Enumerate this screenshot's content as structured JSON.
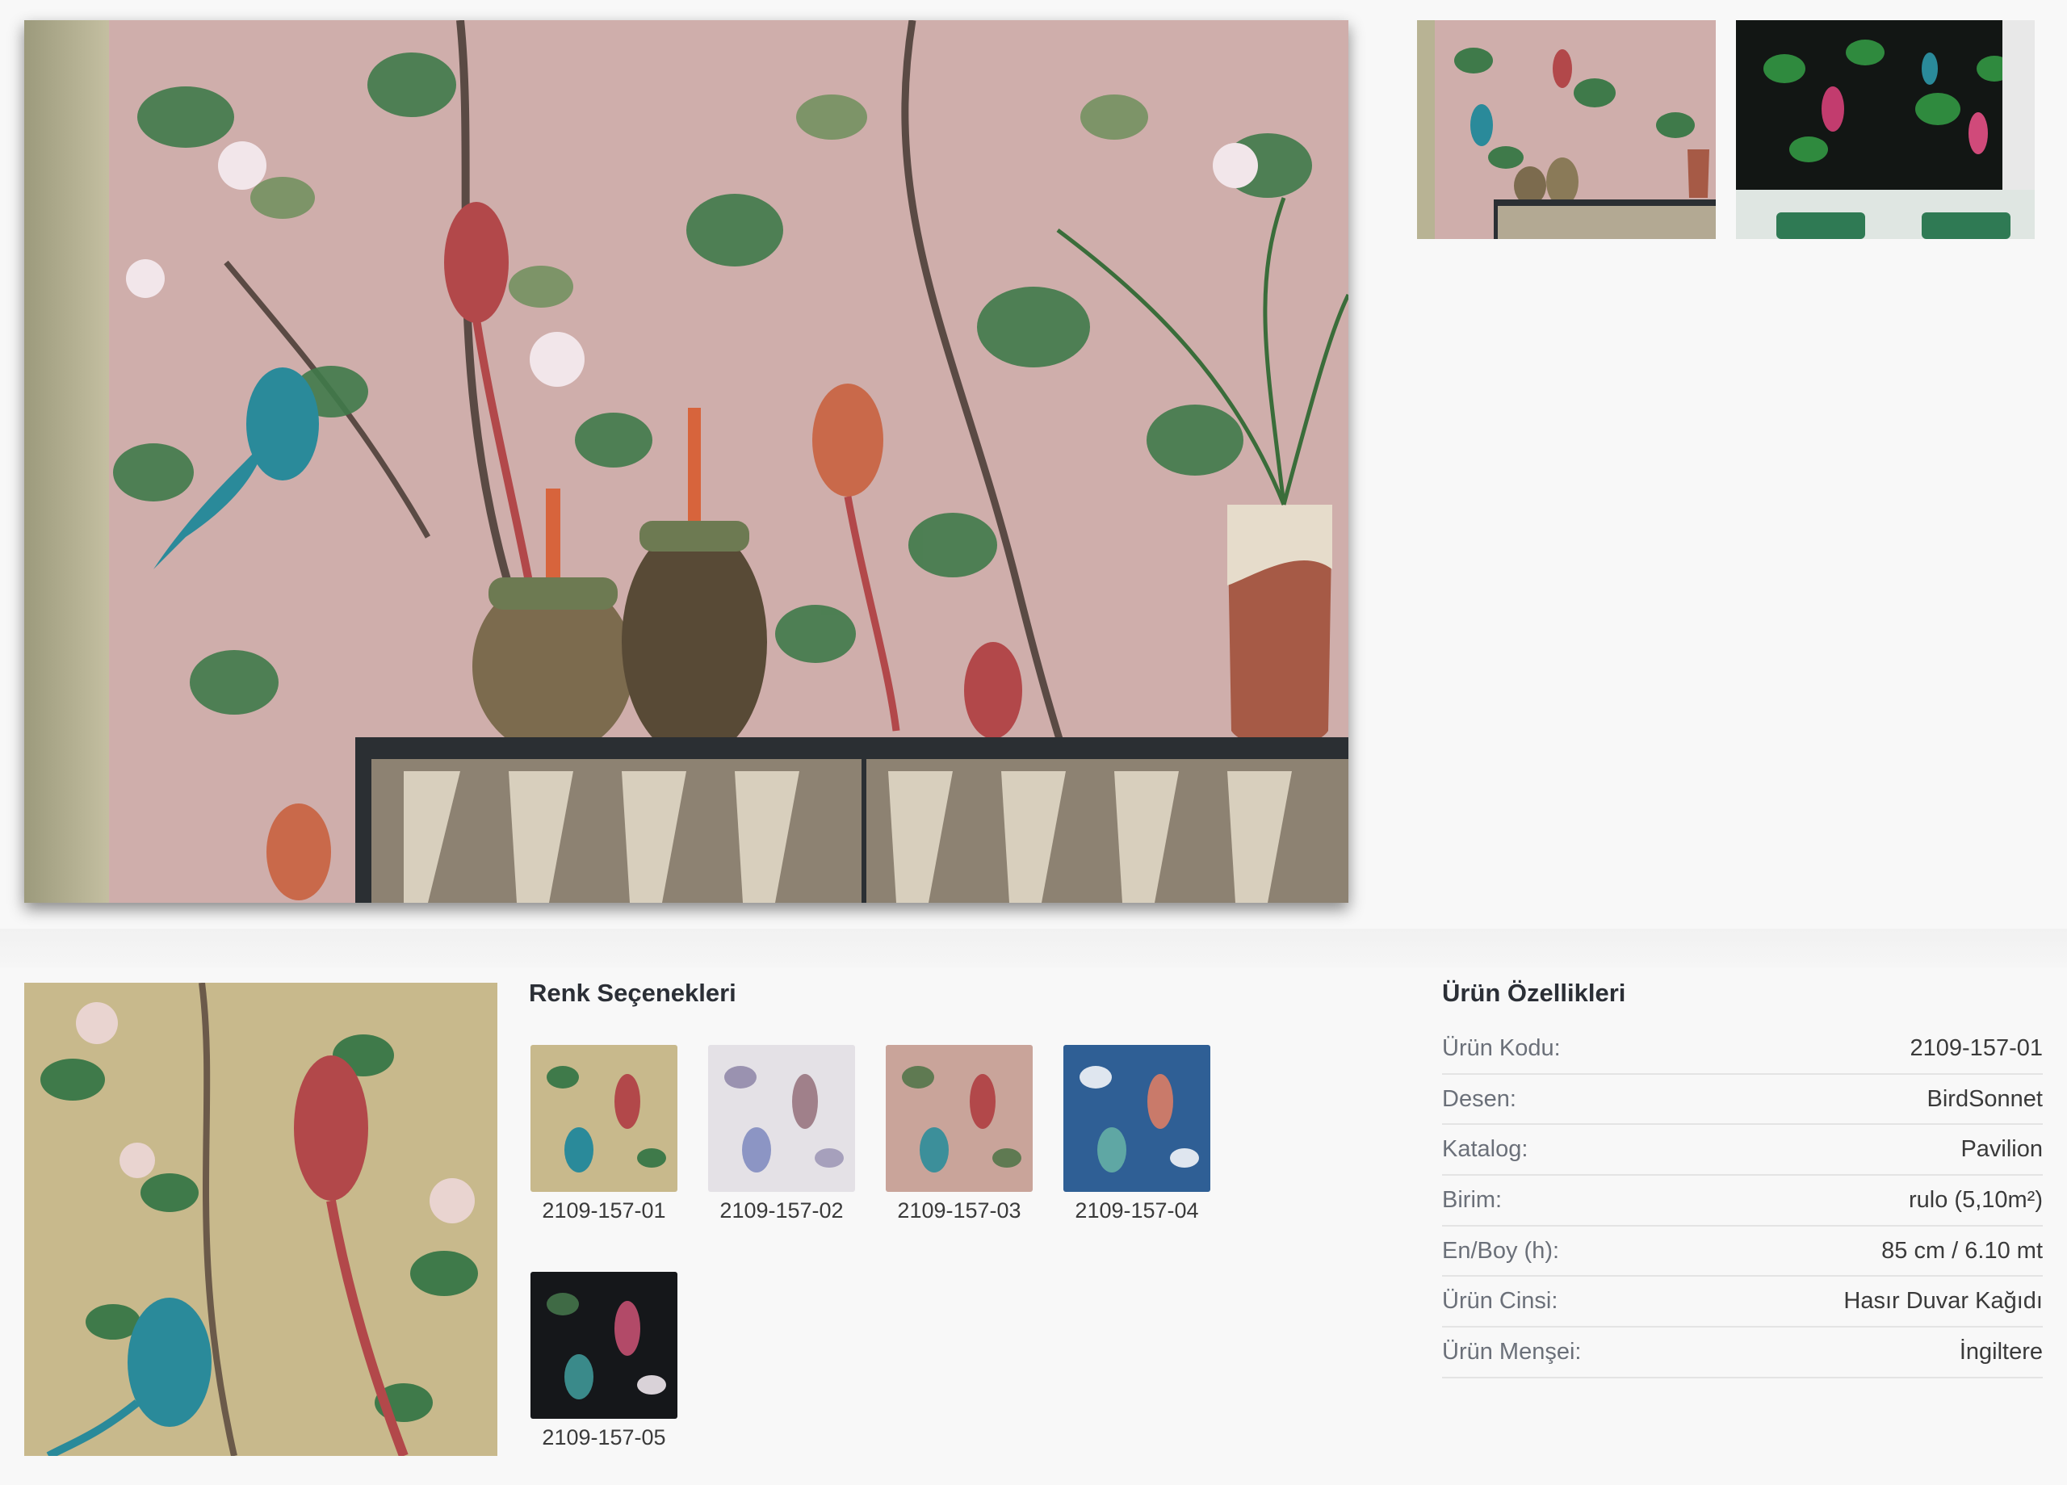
{
  "gallery": {
    "main_image_alt": "",
    "thumbnails": [
      "",
      ""
    ]
  },
  "color_options": {
    "title": "Renk Seçenekleri",
    "swatches": [
      {
        "code": "2109-157-01",
        "bg": "#c8b98c"
      },
      {
        "code": "2109-157-02",
        "bg": "#e4e1e6"
      },
      {
        "code": "2109-157-03",
        "bg": "#c9a49a"
      },
      {
        "code": "2109-157-04",
        "bg": "#2f5f95"
      },
      {
        "code": "2109-157-05",
        "bg": "#15171a"
      }
    ]
  },
  "properties": {
    "title": "Ürün Özellikleri",
    "rows": [
      {
        "key": "Ürün Kodu:",
        "value": "2109-157-01"
      },
      {
        "key": "Desen:",
        "value": "BirdSonnet"
      },
      {
        "key": "Katalog:",
        "value": "Pavilion"
      },
      {
        "key": "Birim:",
        "value": "rulo (5,10m²)"
      },
      {
        "key": "En/Boy (h):",
        "value": "85 cm / 6.10 mt"
      },
      {
        "key": "Ürün Cinsi:",
        "value": "Hasır Duvar Kağıdı"
      },
      {
        "key": "Ürün Menşei:",
        "value": "İngiltere"
      }
    ]
  },
  "colors": {
    "wallpaper_pink": "#cfaeab",
    "wallpaper_beige": "#c8b98c",
    "leaf_green": "#3f7a4a",
    "bird_teal": "#2a8a9a",
    "bird_red": "#b2484a",
    "cabinet_dark": "#2b2f33",
    "cabinet_panel": "#8d8272"
  }
}
